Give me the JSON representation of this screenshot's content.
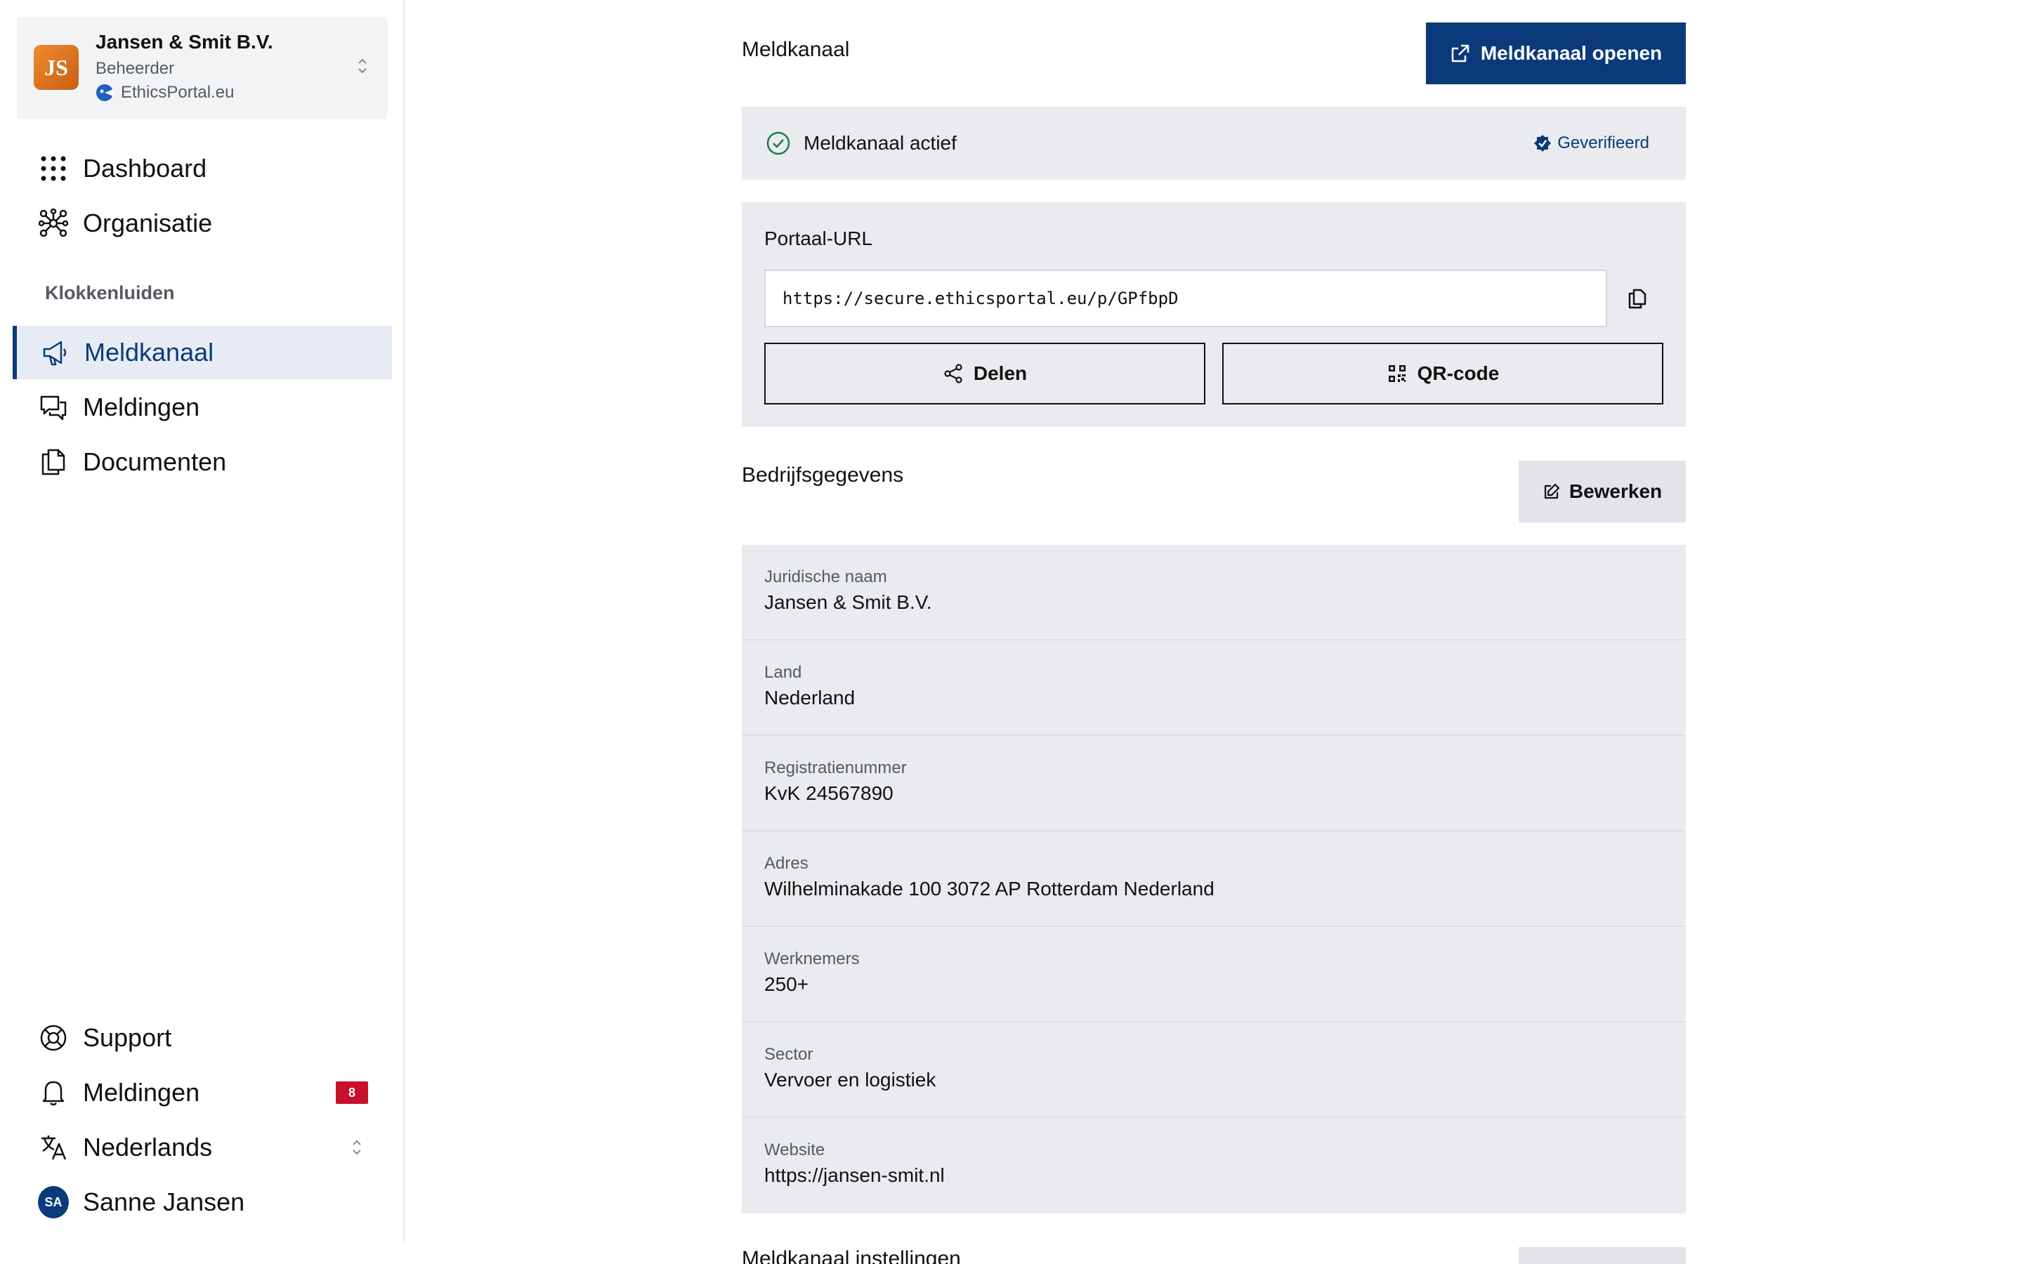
{
  "org": {
    "initials": "JS",
    "name": "Jansen & Smit B.V.",
    "role": "Beheerder",
    "portal": "EthicsPortal.eu",
    "logo_color": "#e07a24"
  },
  "nav": {
    "top": [
      {
        "label": "Dashboard",
        "icon": "grid-icon"
      },
      {
        "label": "Organisatie",
        "icon": "network-icon"
      }
    ],
    "section_label": "Klokkenluiden",
    "section_items": [
      {
        "label": "Meldkanaal",
        "icon": "megaphone-icon",
        "active": true
      },
      {
        "label": "Meldingen",
        "icon": "chat-bubbles-icon"
      },
      {
        "label": "Documenten",
        "icon": "documents-icon"
      }
    ],
    "bottom": {
      "support": "Support",
      "notifications": "Meldingen",
      "notifications_count": "8",
      "language": "Nederlands",
      "user_initials": "SA",
      "user_name": "Sanne Jansen"
    }
  },
  "main": {
    "title": "Meldkanaal",
    "open_button": "Meldkanaal openen",
    "status": "Meldkanaal actief",
    "verified": "Geverifieerd",
    "url_label": "Portaal-URL",
    "url_value": "https://secure.ethicsportal.eu/p/GPfbpD",
    "share_button": "Delen",
    "qr_button": "QR-code",
    "company_title": "Bedrijfsgegevens",
    "edit_button": "Bewerken",
    "details": [
      {
        "label": "Juridische naam",
        "value": "Jansen & Smit B.V."
      },
      {
        "label": "Land",
        "value": "Nederland"
      },
      {
        "label": "Registratienummer",
        "value": "KvK 24567890"
      },
      {
        "label": "Adres",
        "value": "Wilhelminakade 100 3072 AP Rotterdam Nederland"
      },
      {
        "label": "Werknemers",
        "value": "250+"
      },
      {
        "label": "Sector",
        "value": "Vervoer en logistiek"
      },
      {
        "label": "Website",
        "value": "https://jansen-smit.nl"
      }
    ],
    "settings_title": "Meldkanaal instellingen"
  },
  "colors": {
    "primary": "#0b3a7a",
    "panel": "#e9ebee",
    "badge": "#c8102e",
    "success": "#1f7a4a"
  }
}
